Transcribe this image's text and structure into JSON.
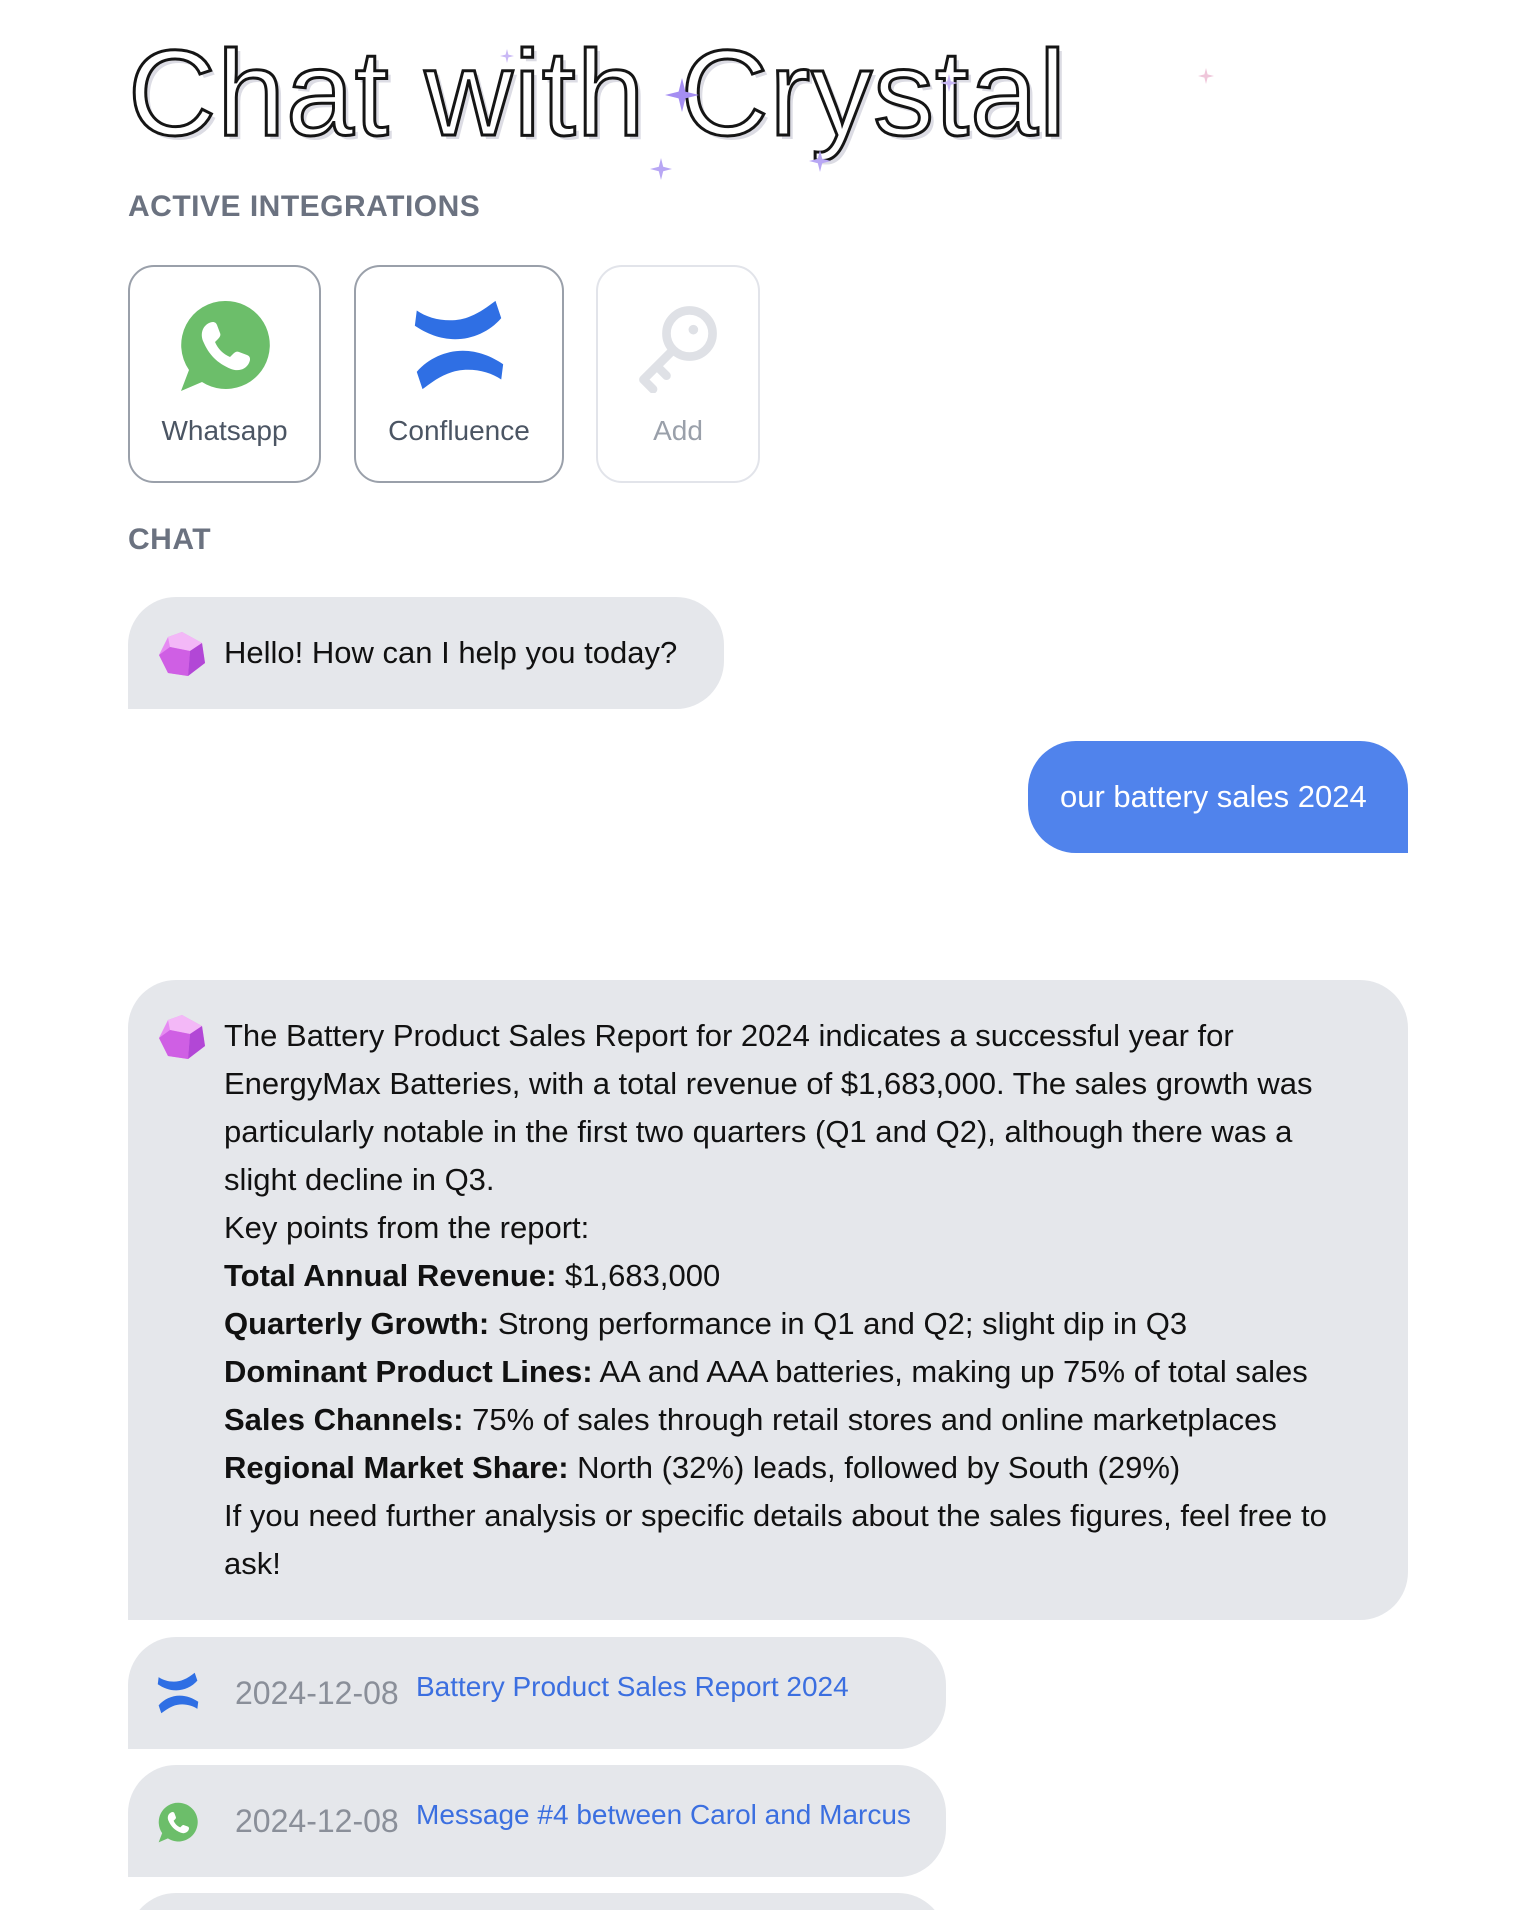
{
  "header": {
    "title": "Chat with Crystal"
  },
  "integrations": {
    "label": "ACTIVE INTEGRATIONS",
    "items": [
      {
        "label": "Whatsapp",
        "icon": "whatsapp-icon",
        "color": "#6cbe6a"
      },
      {
        "label": "Confluence",
        "icon": "confluence-icon",
        "color": "#2f6fe4"
      },
      {
        "label": "Add",
        "icon": "key-icon",
        "color": "#dfe1e6"
      }
    ]
  },
  "chat": {
    "label": "CHAT",
    "greeting": "Hello! How can I help you today?",
    "user_message": "our battery sales 2024",
    "response": {
      "lines": [
        "The Battery Product Sales Report for 2024 indicates a successful year for",
        "EnergyMax Batteries, with a total revenue of $1,683,000. The sales growth was",
        "particularly notable in the first two quarters (Q1 and Q2), although there was a",
        "slight decline in Q3.",
        "Key points from the report:"
      ],
      "points": [
        {
          "label": "Total Annual Revenue:",
          "text": " $1,683,000"
        },
        {
          "label": "Quarterly Growth:",
          "text": " Strong performance in Q1 and Q2; slight dip in Q3"
        },
        {
          "label": "Dominant Product Lines:",
          "text": " AA and AAA batteries, making up 75% of total sales"
        },
        {
          "label": "Sales Channels:",
          "text": " 75% of sales through retail stores and online marketplaces"
        },
        {
          "label": "Regional Market Share:",
          "text": " North (32%) leads, followed by South (29%)"
        }
      ],
      "closing": [
        "If you need further analysis or specific details about the sales figures, feel free to",
        "ask!"
      ]
    },
    "sources": [
      {
        "icon": "confluence-icon",
        "date": "2024-12-08",
        "title": "Battery Product Sales Report 2024"
      },
      {
        "icon": "whatsapp-icon",
        "date": "2024-12-08",
        "title": "Message #4 between Carol and Marcus"
      }
    ]
  },
  "colors": {
    "user_bubble": "#5083ec",
    "bot_bubble": "#e5e7eb",
    "link": "#3b6fe0",
    "section_label": "#6b7280"
  }
}
